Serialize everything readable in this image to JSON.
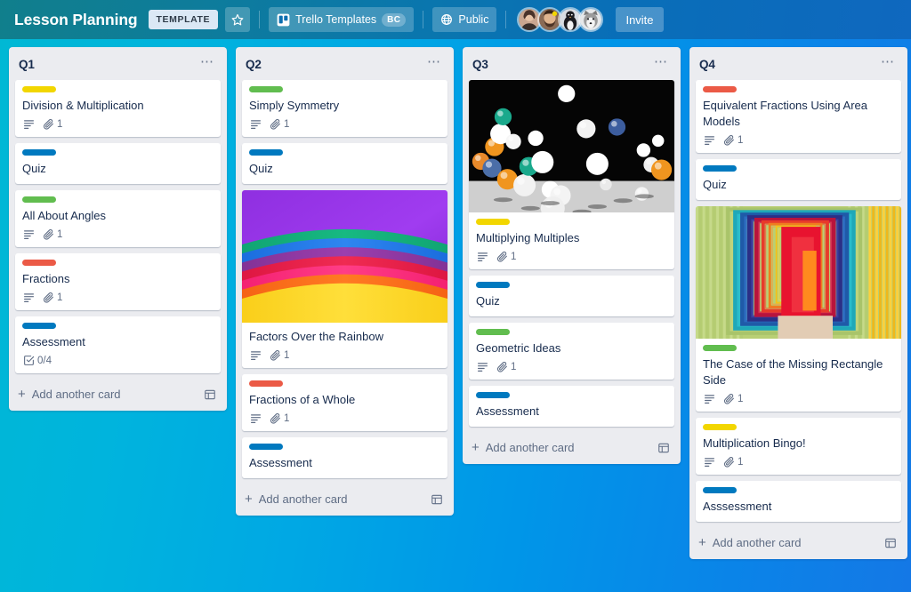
{
  "header": {
    "board_title": "Lesson Planning",
    "template_badge": "TEMPLATE",
    "star_icon": "star-icon",
    "workspace_name": "Trello Templates",
    "workspace_icon": "trello-logo-icon",
    "workspace_initials": "BC",
    "visibility": "Public",
    "visibility_icon": "globe-icon",
    "invite_label": "Invite",
    "members": [
      {
        "name": "member-avatar-1"
      },
      {
        "name": "member-avatar-2"
      },
      {
        "name": "member-avatar-3"
      },
      {
        "name": "member-avatar-4"
      }
    ]
  },
  "colors": {
    "label_yellow": "#f2d600",
    "label_blue": "#0079bf",
    "label_green": "#61bd4f",
    "label_red": "#eb5a46",
    "list_bg": "#ebecf0",
    "card_bg": "#ffffff",
    "text_primary": "#172b4d",
    "text_muted": "#5e6c84",
    "bg_gradient_from": "#00b8d4",
    "bg_gradient_to": "#1478e6"
  },
  "add_card_label": "Add another card",
  "add_card_icon": "card-template-icon",
  "lists": [
    {
      "title": "Q1",
      "menu_icon": "list-menu-icon",
      "cards": [
        {
          "title": "Division & Multiplication",
          "label": "yellow",
          "description_icon": true,
          "attachments": "1"
        },
        {
          "title": "Quiz",
          "label": "blue"
        },
        {
          "title": "All About Angles",
          "label": "green",
          "description_icon": true,
          "attachments": "1"
        },
        {
          "title": "Fractions",
          "label": "red",
          "description_icon": true,
          "attachments": "1"
        },
        {
          "title": "Assessment",
          "label": "blue",
          "checklist": "0/4"
        }
      ]
    },
    {
      "title": "Q2",
      "menu_icon": "list-menu-icon",
      "cards": [
        {
          "title": "Simply Symmetry",
          "label": "green",
          "description_icon": true,
          "attachments": "1"
        },
        {
          "title": "Quiz",
          "label": "blue"
        },
        {
          "title": "Factors Over the Rainbow",
          "cover": "rainbow-arcs",
          "description_icon": true,
          "attachments": "1"
        },
        {
          "title": "Fractions of a Whole",
          "label": "red",
          "description_icon": true,
          "attachments": "1"
        },
        {
          "title": "Assessment",
          "label": "blue"
        }
      ]
    },
    {
      "title": "Q3",
      "menu_icon": "list-menu-icon",
      "cards": [
        {
          "title": "Multiplying Multiples",
          "label": "yellow",
          "cover": "bouncing-spheres",
          "description_icon": true,
          "attachments": "1"
        },
        {
          "title": "Quiz",
          "label": "blue"
        },
        {
          "title": "Geometric Ideas",
          "label": "green",
          "description_icon": true,
          "attachments": "1"
        },
        {
          "title": "Assessment",
          "label": "blue"
        }
      ]
    },
    {
      "title": "Q4",
      "menu_icon": "list-menu-icon",
      "cards": [
        {
          "title": "Equivalent Fractions Using Area Models",
          "label": "red",
          "description_icon": true,
          "attachments": "1"
        },
        {
          "title": "Quiz",
          "label": "blue"
        },
        {
          "title": "The Case of the Missing Rectangle Side",
          "cover": "color-corridor",
          "label": "green",
          "description_icon": true,
          "attachments": "1"
        },
        {
          "title": "Multiplication Bingo!",
          "label": "yellow",
          "description_icon": true,
          "attachments": "1"
        },
        {
          "title": "Asssessment",
          "label": "blue"
        }
      ]
    }
  ]
}
